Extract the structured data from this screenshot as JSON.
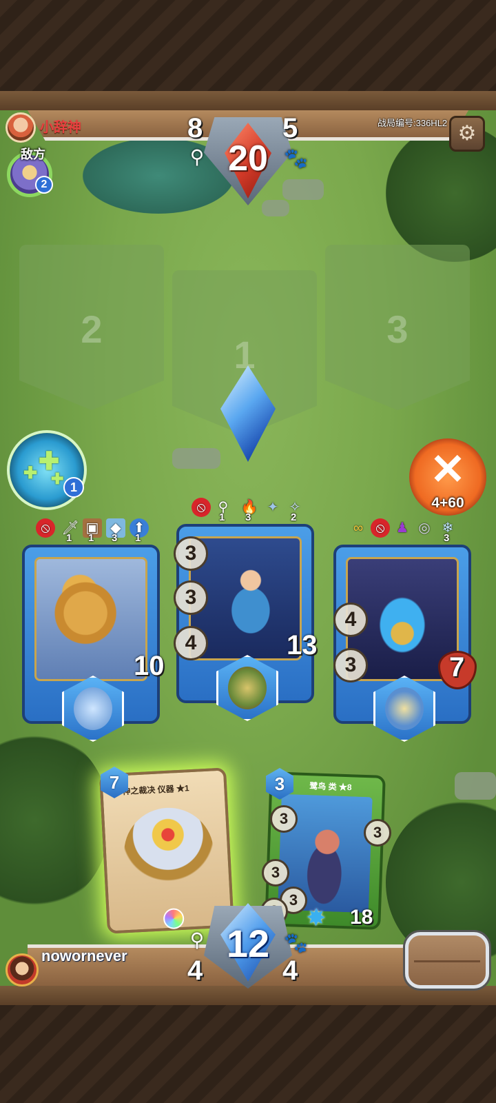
{
  "top": {
    "enemy_name": "小辞神",
    "enemy_label": "敌方",
    "enemy_hero_badge": "2",
    "battle_id": "战局编号:336HL2",
    "enemy_left_stat": "8",
    "enemy_right_stat": "5",
    "center_number": "20"
  },
  "lanes": [
    {
      "number": "2"
    },
    {
      "number": "1"
    },
    {
      "number": "3"
    }
  ],
  "skill": {
    "badge": "1"
  },
  "attack_button": {
    "label": "4+60"
  },
  "units": [
    {
      "statuses": [
        {
          "icon": "no-entry-icon",
          "count": ""
        },
        {
          "icon": "sword-icon",
          "count": "1"
        },
        {
          "icon": "chest-icon",
          "count": "1"
        },
        {
          "icon": "ice-cube-icon",
          "count": "3"
        },
        {
          "icon": "crystal-arrow-icon",
          "count": "1"
        }
      ],
      "hp": "10"
    },
    {
      "statuses": [
        {
          "icon": "no-entry-icon",
          "count": ""
        },
        {
          "icon": "hook-plus-icon",
          "count": "1"
        },
        {
          "icon": "fire-icon",
          "count": "3"
        },
        {
          "icon": "wolf-icon",
          "count": ""
        },
        {
          "icon": "sparkle-wolf-icon",
          "count": "2"
        }
      ],
      "stats": [
        "3",
        "3",
        "4"
      ],
      "hp": "13"
    },
    {
      "statuses": [
        {
          "icon": "link-icon",
          "count": ""
        },
        {
          "icon": "no-entry-icon",
          "count": ""
        },
        {
          "icon": "potion-icon",
          "count": ""
        },
        {
          "icon": "coil-icon",
          "count": ""
        },
        {
          "icon": "frost-icon",
          "count": "3"
        }
      ],
      "stats": [
        "4",
        "3"
      ],
      "hp": "7"
    }
  ],
  "hand": [
    {
      "cost": "7",
      "title": "神之裁决  仪器  ★1"
    },
    {
      "cost": "3",
      "title": "鹭鸟 类 ★8",
      "side_values": [
        "3",
        "3",
        "3",
        "3",
        "2"
      ],
      "hp": "18"
    }
  ],
  "bottom": {
    "player_name": "nowornever",
    "left_stat": "4",
    "right_stat": "4",
    "center_number": "12"
  },
  "colors": {
    "accent_blue": "#2a6fc4",
    "attack_orange": "#ef6a22",
    "enemy_name_red": "#e84040",
    "highlight_green": "#cfff5a"
  }
}
